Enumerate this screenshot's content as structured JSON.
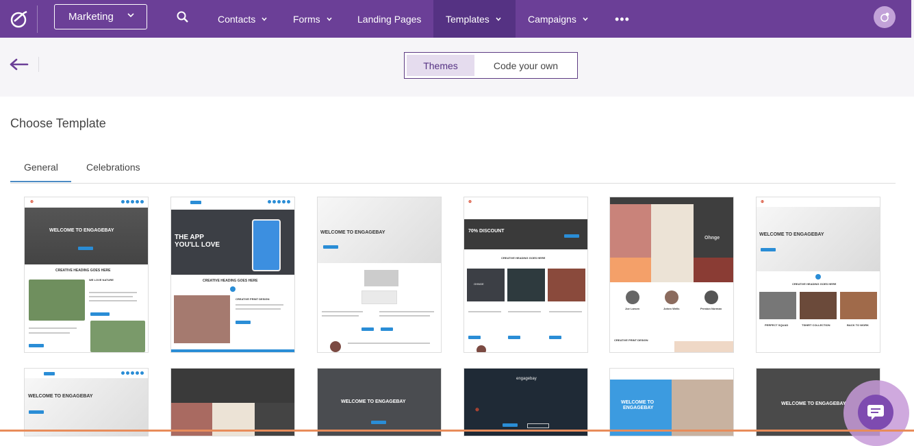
{
  "nav": {
    "workspace": "Marketing",
    "items": [
      {
        "label": "Contacts",
        "has_dropdown": true,
        "active": false
      },
      {
        "label": "Forms",
        "has_dropdown": true,
        "active": false
      },
      {
        "label": "Landing Pages",
        "has_dropdown": false,
        "active": false
      },
      {
        "label": "Templates",
        "has_dropdown": true,
        "active": true
      },
      {
        "label": "Campaigns",
        "has_dropdown": true,
        "active": false
      }
    ],
    "more_label": "•••",
    "icons": [
      "engagebay-logo-icon",
      "search-icon",
      "chevron-down-icon",
      "more-icon",
      "user-avatar-icon"
    ]
  },
  "subheader": {
    "toggle": {
      "themes": "Themes",
      "code": "Code your own",
      "selected": "Themes"
    }
  },
  "main": {
    "title": "Choose Template",
    "tabs": [
      {
        "label": "General",
        "active": true
      },
      {
        "label": "Celebrations",
        "active": false
      }
    ]
  },
  "templates": {
    "t1": {
      "heading": "WELCOME TO ENGAGEBAY",
      "sub": "CREATIVE HEADING GOES HERE",
      "love": "WE LOVE NATURE"
    },
    "t2": {
      "heading1": "THE APP",
      "heading2": "YOU'LL LOVE",
      "sub": "CREATIVE HEADING GOES HERE",
      "sub2": "CREATIVE PRINT DESIGN"
    },
    "t3": {
      "heading": "WELCOME TO ENGAGEBAY"
    },
    "t4": {
      "heading": "70% DISCOUNT",
      "sub": "CREATIVE HEADING GOES HERE",
      "logo_word": "OHNGE"
    },
    "t5": {
      "logo_word": "Ohnge",
      "p1": "Joe Larsen",
      "p2": "Johnn Wells",
      "p3": "Preston Norman",
      "sub": "CREATIVE PRINT DESIGN"
    },
    "t6": {
      "heading": "WELCOME TO ENGAGEBAY",
      "sub": "CREATIVE HEADING GOES HERE",
      "c1": "PERFECT SQUAD",
      "c2": "TSHIRT COLLECTION",
      "c3": "BACK TO WORK"
    },
    "t7": {
      "heading": "WELCOME TO ENGAGEBAY"
    },
    "t9": {
      "heading": "WELCOME TO ENGAGEBAY"
    },
    "t10": {
      "brand": "engagebay"
    },
    "t11": {
      "heading1": "WELCOME TO",
      "heading2": "ENGAGEBAY"
    },
    "t12": {
      "heading": "WELCOME TO ENGAGEBAY"
    }
  },
  "colors": {
    "nav_bg": "#6b3f97",
    "nav_active": "#553283",
    "accent_blue": "#2a8dd6",
    "toggle_border": "#5c3a82"
  }
}
